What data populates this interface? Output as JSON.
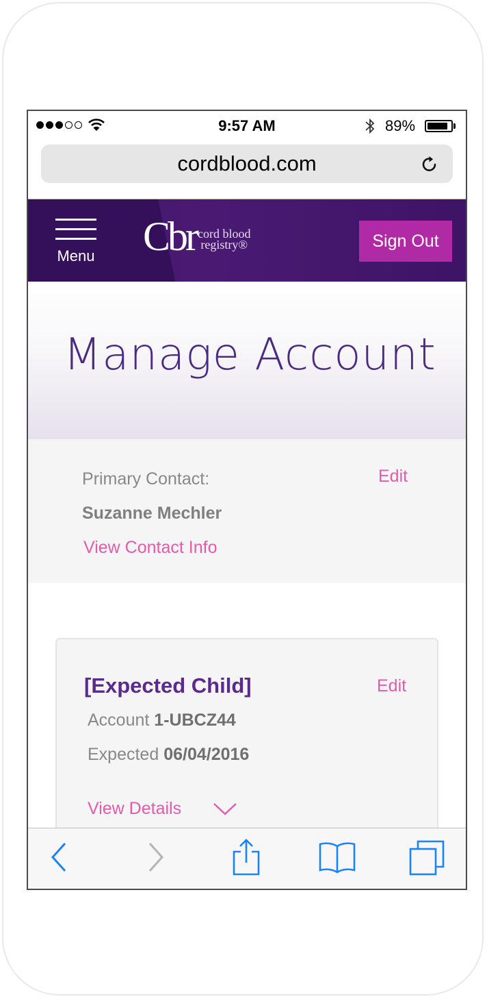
{
  "status_bar": {
    "time": "9:57 AM",
    "battery": "89%",
    "battery_level": 0.89,
    "signal_bars": 3,
    "icons": [
      "signal-dots",
      "wifi-icon",
      "bluetooth-icon",
      "battery-icon"
    ]
  },
  "browser": {
    "url": "cordblood.com",
    "reload_icon": "reload-icon"
  },
  "site_header": {
    "menu_label": "Menu",
    "logo_mark": "Cbr",
    "logo_line1": "cord blood",
    "logo_line2": "registry®",
    "sign_out_label": "Sign Out"
  },
  "hero": {
    "title": "Manage Account"
  },
  "contact": {
    "label": "Primary Contact:",
    "name": "Suzanne Mechler",
    "view_link": "View Contact Info",
    "edit_label": "Edit"
  },
  "child_card": {
    "name": "[Expected Child]",
    "edit_label": "Edit",
    "account_label": "Account",
    "account_number": "1-UBCZ44",
    "expected_label": "Expected",
    "expected_date": "06/04/2016",
    "details_link": "View Details"
  },
  "toolbar": {
    "icons": [
      "back-icon",
      "forward-icon",
      "share-icon",
      "bookmarks-icon",
      "tabs-icon"
    ]
  },
  "colors": {
    "header_purple": "#441770",
    "accent_pink": "#e35bab",
    "signout_magenta": "#b02aa6",
    "title_purple": "#4a2a82",
    "ios_blue": "#1a82fb"
  }
}
